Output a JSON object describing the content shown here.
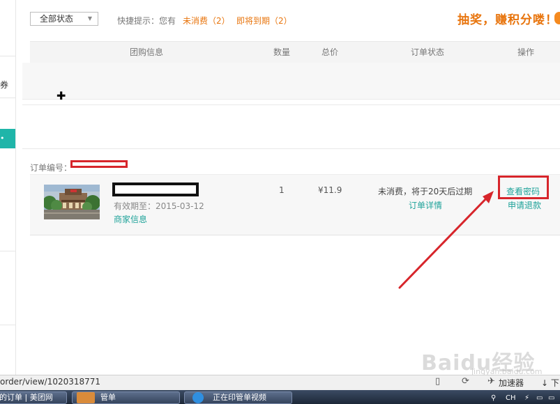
{
  "sidebar": {
    "partial_label": "券",
    "active_glyph": "•"
  },
  "filter": {
    "status_select": "全部状态",
    "tips_prefix": "快捷提示：您有",
    "unused_link": "未消费（2）",
    "expiring_link": "即将到期（2）"
  },
  "promo": {
    "text": "抽奖，赚积分喽！"
  },
  "table": {
    "headers": [
      "团购信息",
      "数量",
      "总价",
      "订单状态",
      "操作"
    ]
  },
  "order": {
    "order_no_label": "订单编号：",
    "valid_until": "有效期至：2015-03-12",
    "merchant_link": "商家信息",
    "quantity": "1",
    "price": "¥11.9",
    "status": "未消费，将于20天后过期",
    "detail_link": "订单详情",
    "view_password": "查看密码",
    "refund": "申请退款"
  },
  "statusbar": {
    "url": "order/view/1020318771",
    "accelerator": "加速器",
    "download": "下"
  },
  "taskbar": {
    "items": [
      "的订单 | 美团网",
      "管单",
      "正在印管单视频"
    ],
    "tray_text": "CH"
  },
  "watermark": {
    "text": "Baidu经验",
    "sub": "jingyan.baidu.com"
  },
  "colors": {
    "accent_teal": "#1fa39a",
    "orange": "#e8740c",
    "annotation_red": "#d7252b"
  }
}
